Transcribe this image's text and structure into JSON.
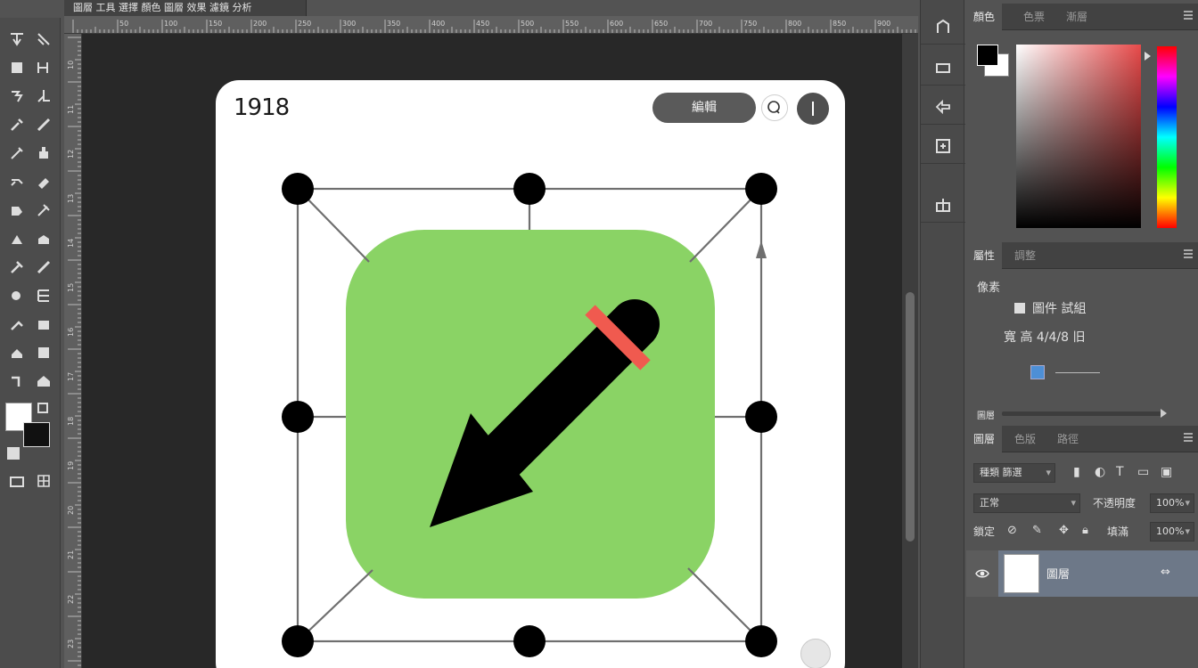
{
  "document": {
    "tab_title": "圖層  工具 選擇 顏色 圖層 效果 濾鏡 分析"
  },
  "rulers": {
    "top_labels": [
      "50",
      "100",
      "150",
      "200",
      "250",
      "300",
      "350",
      "400",
      "450",
      "500",
      "550",
      "600",
      "650",
      "700",
      "750",
      "800",
      "850",
      "900"
    ],
    "left_labels": [
      "10",
      "11",
      "12",
      "13",
      "14",
      "15",
      "16",
      "17",
      "18",
      "19",
      "20",
      "21",
      "22",
      "23"
    ]
  },
  "artboard": {
    "number": "1918",
    "pill_label": "編輯"
  },
  "panels": {
    "color": {
      "tab_active": "顏色",
      "tabs": [
        "色票",
        "漸層"
      ]
    },
    "properties": {
      "tab_active": "屬性",
      "tabs": [
        "調整"
      ],
      "title": "像素",
      "row1": "圖件 試組",
      "row2": "寬 高 4/4/8 旧",
      "slider_label": "圖層"
    },
    "layers": {
      "tab_active": "圖層",
      "tabs": [
        "色版",
        "路徑"
      ],
      "filter_label": "種類 篩選",
      "blend_mode": "正常",
      "opacity_label": "不透明度",
      "opacity_value": "100%",
      "lock_label": "鎖定",
      "fill_label": "填滿",
      "fill_value": "100%",
      "layer_name": "圖層"
    }
  },
  "colors": {
    "icon_green": "#8ad365",
    "icon_black": "#000000",
    "icon_red": "#f05a4f",
    "ps_dark": "#282828",
    "ps_panel": "#535353"
  }
}
